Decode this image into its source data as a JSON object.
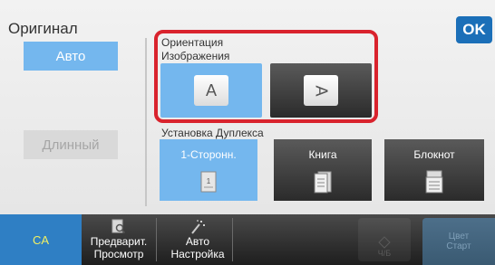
{
  "header": {
    "title": "Оригинал",
    "ok_label": "OK"
  },
  "left": {
    "auto_label": "Авто",
    "long_label": "Длинный"
  },
  "orientation": {
    "label_line1": "Ориентация",
    "label_line2": "Изображения",
    "portrait_glyph": "A",
    "landscape_glyph": "A"
  },
  "duplex": {
    "label": "Установка Дуплекса",
    "options": [
      {
        "label": "1-Сторонн.",
        "icon": "one-sided-doc-icon"
      },
      {
        "label": "Книга",
        "icon": "book-doc-icon"
      },
      {
        "label": "Блокнот",
        "icon": "tablet-doc-icon"
      }
    ]
  },
  "bottom": {
    "ca_label": "CA",
    "preview_line1": "Предварит.",
    "preview_line2": "Просмотр",
    "auto_line1": "Авто",
    "auto_line2": "Настройка",
    "bw_start_label": "Ч/Б",
    "color_start_line1": "Цвет",
    "color_start_line2": "Старт"
  },
  "colors": {
    "accent": "#74b7ee",
    "ok": "#1b6fb8",
    "highlight": "#d9232d",
    "ca": "#2f7fc4"
  }
}
